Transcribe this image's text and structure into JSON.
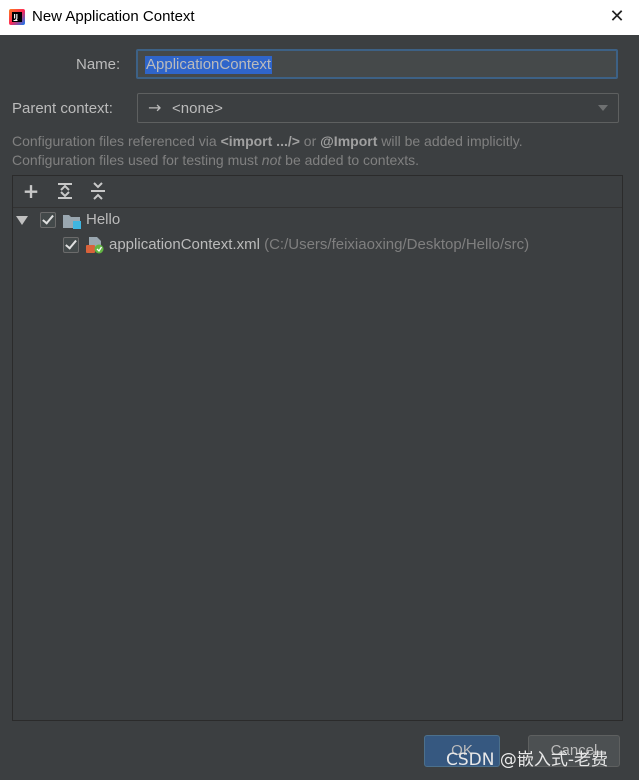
{
  "window": {
    "title": "New Application Context",
    "app_icon": "intellij-idea-icon",
    "close_glyph": "✕"
  },
  "form": {
    "name_label": "Name:",
    "name_value": "ApplicationContext",
    "parent_label": "Parent context:",
    "parent_arrow": "→",
    "parent_value": "<none>"
  },
  "hints": {
    "line1_prefix": "Configuration files referenced via ",
    "line1_import_tag": "<import .../>",
    "line1_mid": " or ",
    "line1_import_annot": "@Import",
    "line1_suffix": " will be added implicitly.",
    "line2_prefix": "Configuration files used for testing must ",
    "line2_not": "not",
    "line2_suffix": " be added to contexts."
  },
  "toolbar": {
    "add": "+",
    "expand_all": "expand-all-icon",
    "collapse_all": "collapse-all-icon"
  },
  "tree": {
    "module": {
      "label": "Hello",
      "checked": true
    },
    "file": {
      "label": "applicationContext.xml",
      "path": "(C:/Users/feixiaoxing/Desktop/Hello/src)",
      "checked": true
    }
  },
  "buttons": {
    "ok": "OK",
    "cancel": "Cancel"
  },
  "watermark": "CSDN @嵌入式-老费",
  "colors": {
    "background": "#3c3f41",
    "selection": "#2f65ca",
    "ok_button": "#365880"
  }
}
